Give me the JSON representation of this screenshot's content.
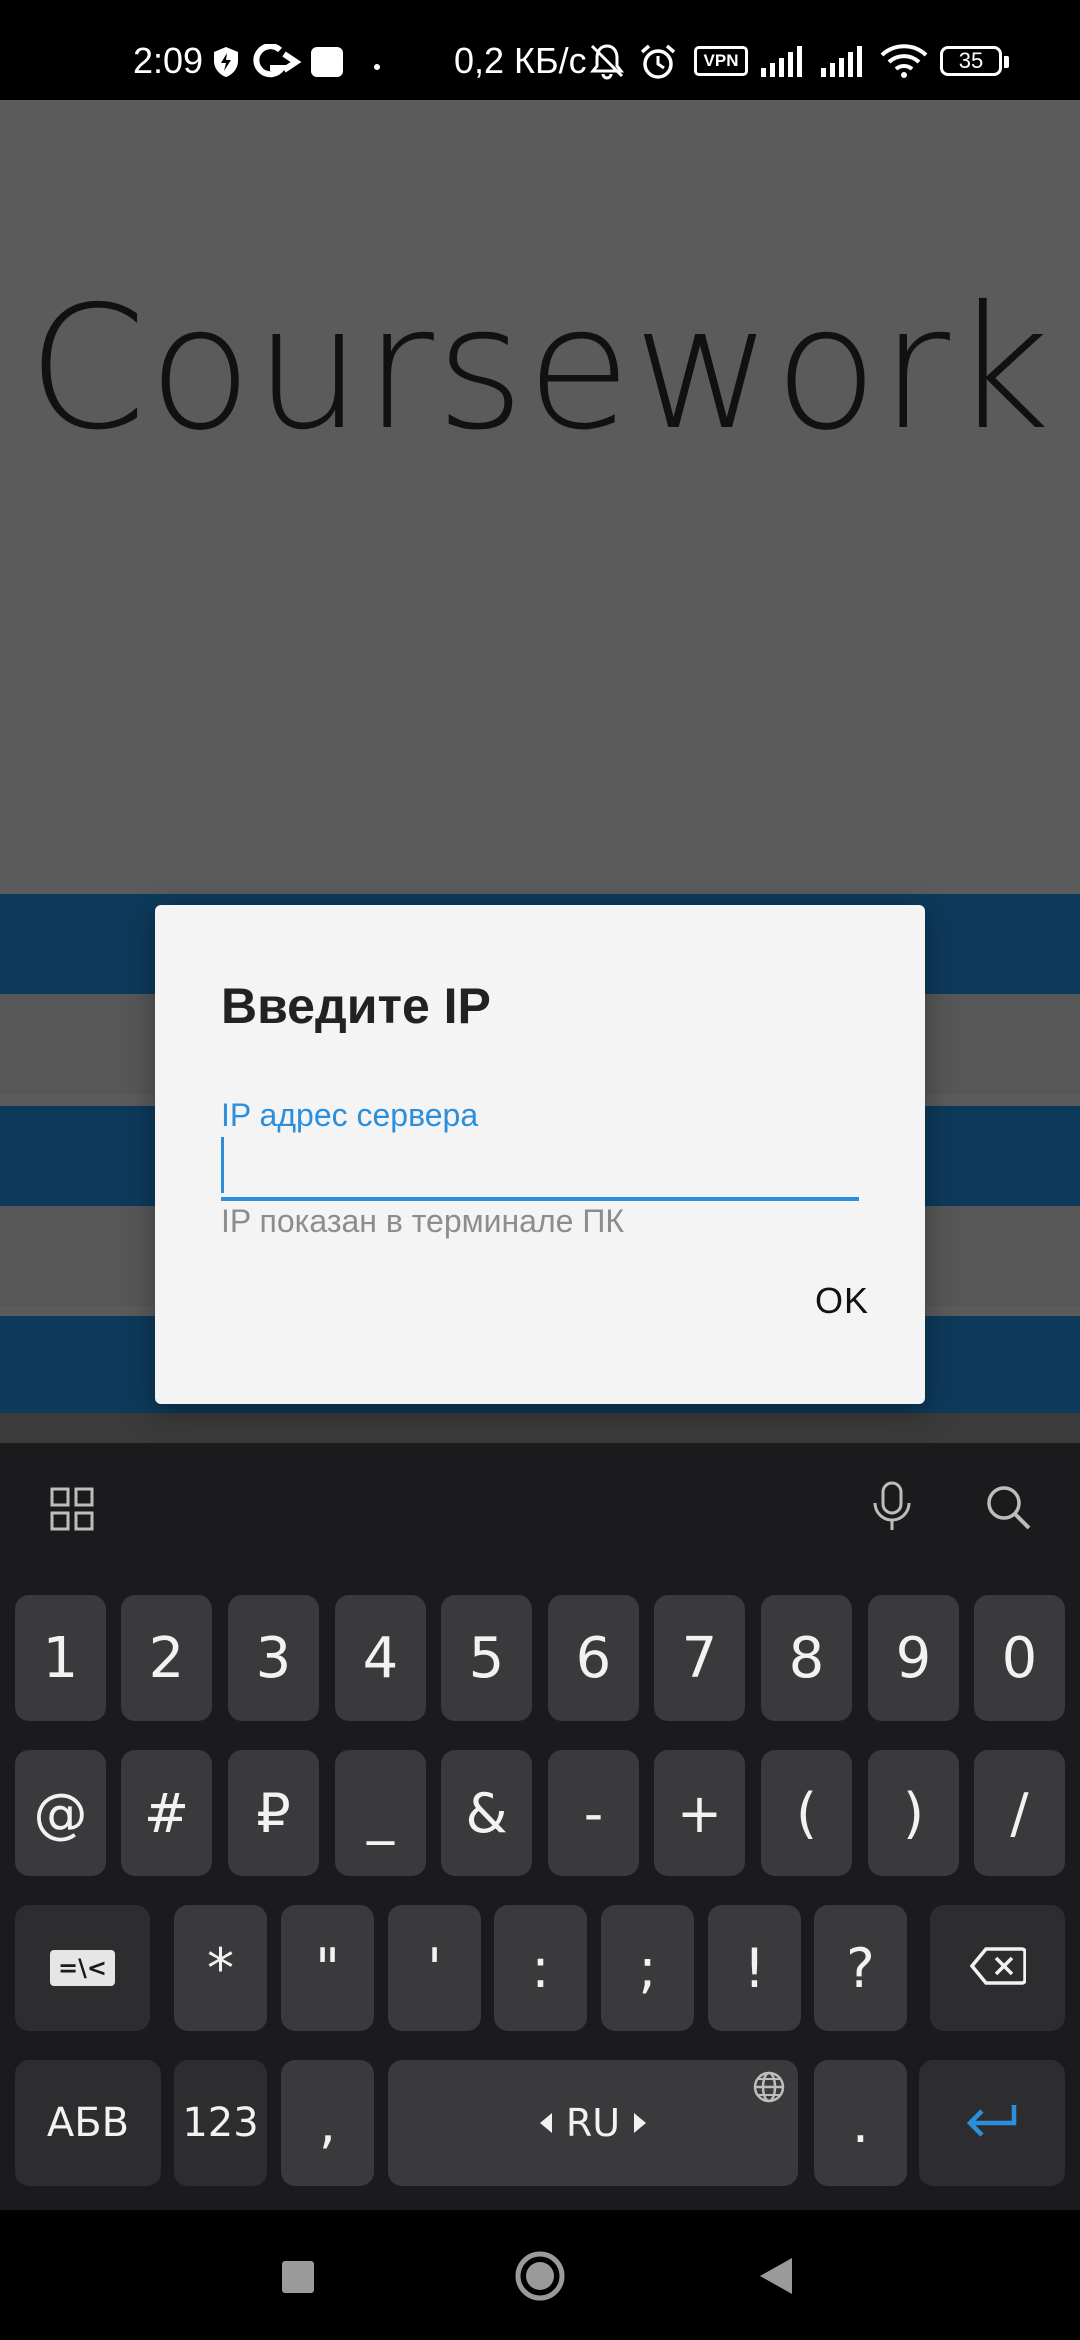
{
  "status_bar": {
    "time": "2:09",
    "net_speed": "0,2 КБ/с",
    "vpn_label": "VPN",
    "battery": "35",
    "icons": [
      "shield-icon",
      "app-g-icon",
      "square-app-icon",
      "dot-icon",
      "mute-bell-icon",
      "alarm-icon",
      "vpn-icon",
      "signal-icon",
      "signal-icon",
      "wifi-icon",
      "battery-icon"
    ]
  },
  "app": {
    "title": "Coursework"
  },
  "dialog": {
    "title": "Введите IP",
    "field_label": "IP адрес сервера",
    "field_value": "",
    "helper_text": "IP показан в терминале ПК",
    "ok_label": "OK"
  },
  "keyboard": {
    "toolbar_icons": [
      "grid-icon",
      "microphone-icon",
      "search-icon"
    ],
    "row1": [
      "1",
      "2",
      "3",
      "4",
      "5",
      "6",
      "7",
      "8",
      "9",
      "0"
    ],
    "row2": [
      "@",
      "#",
      "₽",
      "_",
      "&",
      "-",
      "+",
      "(",
      ")",
      "/"
    ],
    "row3_keys": [
      "*",
      "\"",
      "'",
      ":",
      ";",
      "!",
      "?"
    ],
    "switch_sym_label": "=\\<",
    "row4": {
      "abc_label": "АБВ",
      "num_label": "123",
      "comma": ",",
      "space_label": "RU",
      "period": "."
    }
  },
  "nav_bar": {
    "icons": [
      "recents-icon",
      "home-icon",
      "back-icon"
    ]
  },
  "colors": {
    "accent": "#2b8fdc",
    "stripe_blue": "#0d3a5a",
    "keyboard_bg": "#1b1b1d",
    "key_bg": "#3a3a3c"
  }
}
